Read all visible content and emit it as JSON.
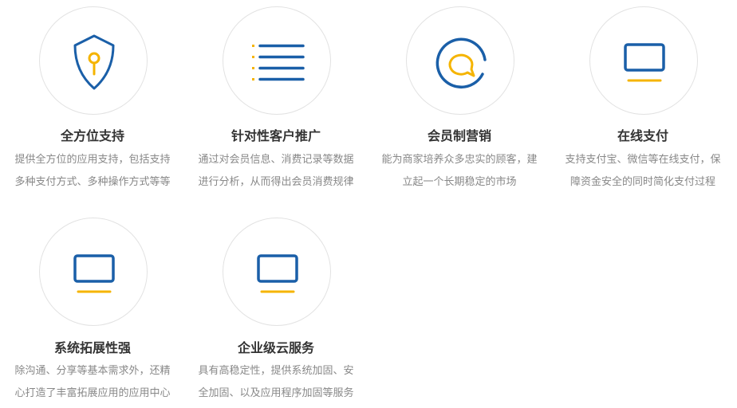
{
  "colors": {
    "icon_blue": "#1a5fa8",
    "icon_yellow": "#f5b400",
    "title": "#333333",
    "desc": "#888888",
    "circle_border": "#e2e2e2"
  },
  "features": [
    {
      "icon": "shield-key-icon",
      "title": "全方位支持",
      "desc_line1": "提供全方位的应用支持，包括支持",
      "desc_line2": "多种支付方式、多种操作方式等等"
    },
    {
      "icon": "list-icon",
      "title": "针对性客户推广",
      "desc_line1": "通过对会员信息、消费记录等数据",
      "desc_line2": "进行分析，从而得出会员消费规律"
    },
    {
      "icon": "chat-bubble-icon",
      "title": "会员制营销",
      "desc_line1": "能为商家培养众多忠实的顾客，建",
      "desc_line2": "立起一个长期稳定的市场"
    },
    {
      "icon": "monitor-icon",
      "title": "在线支付",
      "desc_line1": "支持支付宝、微信等在线支付，保",
      "desc_line2": "障资金安全的同时简化支付过程"
    },
    {
      "icon": "monitor-icon",
      "title": "系统拓展性强",
      "desc_line1": "除沟通、分享等基本需求外，还精",
      "desc_line2": "心打造了丰富拓展应用的应用中心"
    },
    {
      "icon": "monitor-icon",
      "title": "企业级云服务",
      "desc_line1": "具有高稳定性，提供系统加固、安",
      "desc_line2": "全加固、以及应用程序加固等服务"
    }
  ]
}
